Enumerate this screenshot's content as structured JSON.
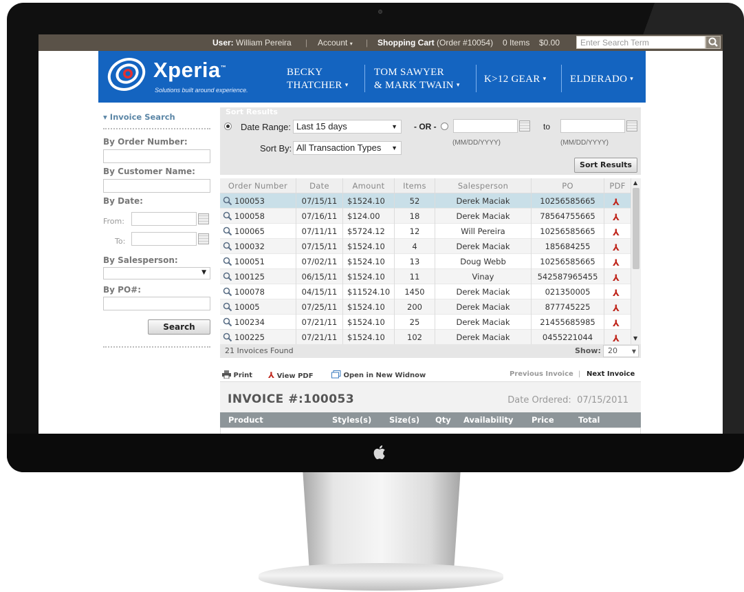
{
  "topbar": {
    "user_label": "User:",
    "user_name": "William Pereira",
    "separator": "|",
    "account_label": "Account",
    "cart_label": "Shopping Cart",
    "cart_order": "(Order #10054)",
    "cart_items": "0 Items",
    "cart_total": "$0.00",
    "search_placeholder": "Enter Search Term"
  },
  "header": {
    "brand_name": "Xperia",
    "brand_trademark": "™",
    "brand_tagline": "Solutions built around experience.",
    "nav": [
      {
        "line1": "BECKY",
        "line2": "THATCHER"
      },
      {
        "line1": "TOM SAWYER",
        "line2": "& MARK TWAIN"
      },
      {
        "label": "K>12 GEAR"
      },
      {
        "label": "ELDERADO"
      }
    ],
    "caret": "▾"
  },
  "sidebar": {
    "title": "Invoice Search",
    "caret": "▾",
    "order_number_label": "By Order Number:",
    "customer_name_label": "By Customer Name:",
    "date_label": "By Date:",
    "from_label": "From:",
    "to_label": "To:",
    "salesperson_label": "By Salesperson:",
    "po_label": "By PO#:",
    "search_button": "Search"
  },
  "sort": {
    "heading": "Sort Results",
    "date_range_label": "Date Range:",
    "date_range_value": "Last 15 days",
    "or_label": "- OR -",
    "to_label": "to",
    "format_hint": "(MM/DD/YYYY)",
    "sort_by_label": "Sort By:",
    "sort_by_value": "All Transaction Types",
    "sort_button": "Sort Results"
  },
  "table": {
    "columns": [
      "Order Number",
      "Date",
      "Amount",
      "Items",
      "Salesperson",
      "PO",
      "PDF"
    ],
    "rows": [
      {
        "order": "100053",
        "date": "07/15/11",
        "amount": "$1524.10",
        "items": "52",
        "salesperson": "Derek Maciak",
        "po": "10256585665"
      },
      {
        "order": "100058",
        "date": "07/16/11",
        "amount": "$124.00",
        "items": "18",
        "salesperson": "Derek Maciak",
        "po": "78564755665"
      },
      {
        "order": "100065",
        "date": "07/11/11",
        "amount": "$5724.12",
        "items": "12",
        "salesperson": "Will Pereira",
        "po": "10256585665"
      },
      {
        "order": "100032",
        "date": "07/15/11",
        "amount": "$1524.10",
        "items": "4",
        "salesperson": "Derek Maciak",
        "po": "185684255"
      },
      {
        "order": "100051",
        "date": "07/02/11",
        "amount": "$1524.10",
        "items": "13",
        "salesperson": "Doug Webb",
        "po": "10256585665"
      },
      {
        "order": "100125",
        "date": "06/15/11",
        "amount": "$1524.10",
        "items": "11",
        "salesperson": "Vinay",
        "po": "542587965455"
      },
      {
        "order": "100078",
        "date": "04/15/11",
        "amount": "$11524.10",
        "items": "1450",
        "salesperson": "Derek Maciak",
        "po": "021350005"
      },
      {
        "order": "10005",
        "date": "07/25/11",
        "amount": "$1524.10",
        "items": "200",
        "salesperson": "Derek Maciak",
        "po": "877745225"
      },
      {
        "order": "100234",
        "date": "07/21/11",
        "amount": "$1524.10",
        "items": "25",
        "salesperson": "Derek Maciak",
        "po": "21455685985"
      },
      {
        "order": "100225",
        "date": "07/21/11",
        "amount": "$1524.10",
        "items": "102",
        "salesperson": "Derek Maciak",
        "po": "0455221044"
      }
    ],
    "selected_row": 0,
    "found_text": "21 Invoices Found",
    "show_label": "Show:",
    "show_value": "20"
  },
  "actions": {
    "print": "Print",
    "view_pdf": "View PDF",
    "open_new": "Open in New Widnow",
    "previous": "Previous Invoice",
    "separator": "|",
    "next": "Next Invoice"
  },
  "invoice": {
    "title": "INVOICE #:100053",
    "date_label": "Date Ordered:",
    "date_value": "07/15/2011",
    "columns": [
      "Product",
      "Styles(s)",
      "Size(s)",
      "Qty",
      "Availability",
      "Price",
      "Total"
    ]
  },
  "colors": {
    "topbar": "#5a5248",
    "header": "#1464c0",
    "selected_row": "#c9dfe8",
    "invoice_head": "#8d9599"
  },
  "icons": [
    "search-icon",
    "calendar-icon",
    "magnifier-icon",
    "pdf-icon",
    "print-icon",
    "window-icon",
    "apple-logo-icon"
  ]
}
